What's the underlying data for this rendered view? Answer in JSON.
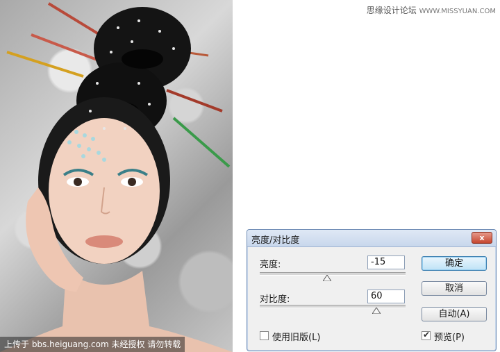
{
  "site": {
    "name": "思缘设计论坛",
    "url": "WWW.MISSYUAN.COM"
  },
  "photo": {
    "watermark": "上传于 bbs.heiguang.com  未经授权  请勿转载"
  },
  "dialog": {
    "title": "亮度/对比度",
    "close_label": "x",
    "brightness": {
      "label": "亮度:",
      "value": "-15",
      "slider_fraction": 0.46
    },
    "contrast": {
      "label": "对比度:",
      "value": "60",
      "slider_fraction": 0.8
    },
    "buttons": {
      "ok": "确定",
      "cancel": "取消",
      "auto": "自动(A)"
    },
    "legacy": {
      "label": "使用旧版(L)",
      "checked": false
    },
    "preview": {
      "label": "预览(P)",
      "checked": true
    }
  }
}
